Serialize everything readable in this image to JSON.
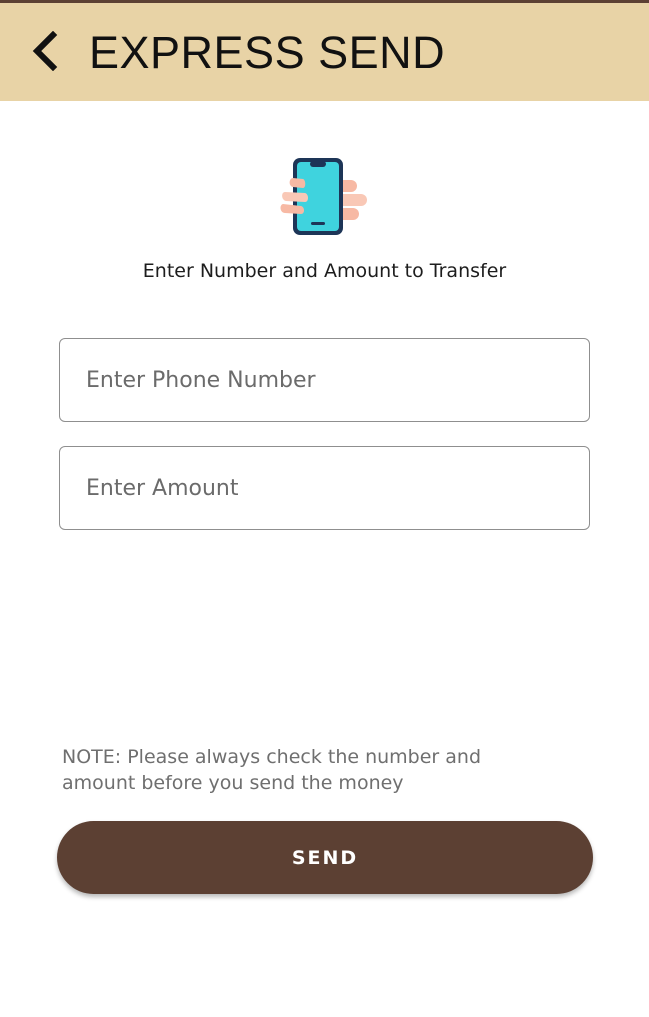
{
  "app_bar": {
    "back_icon": "chevron-left-icon",
    "title": "EXPRESS SEND",
    "background": "#e8d3a6"
  },
  "hero": {
    "icon": "hand-holding-phone-icon"
  },
  "instruction": "Enter Number and Amount to Transfer",
  "form": {
    "phone": {
      "placeholder": "Enter Phone Number",
      "value": ""
    },
    "amount": {
      "placeholder": "Enter Amount",
      "value": ""
    }
  },
  "note": {
    "line1": "NOTE: Please always check the number and",
    "line2": "amount before you send the money"
  },
  "send_button": {
    "label": "SEND",
    "color": "#5c4033"
  }
}
